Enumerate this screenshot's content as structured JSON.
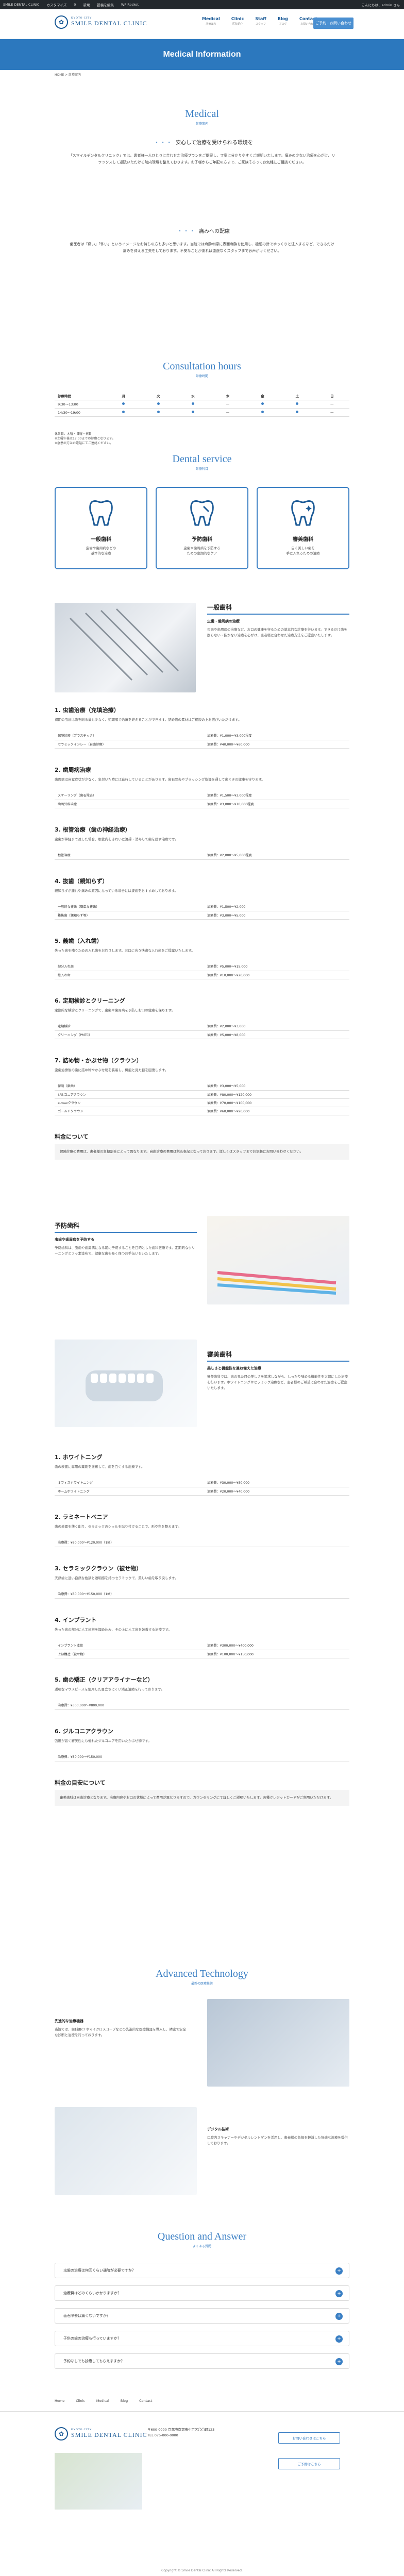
{
  "adminbar": {
    "items": [
      "SMILE DENTAL CLINIC",
      "カスタマイズ",
      "0",
      "新規",
      "投稿を編集",
      "WP Rocket"
    ],
    "right": "こんにちは、admin さん"
  },
  "header": {
    "logo_small": "KYOTO CITY",
    "logo_big": "SMILE DENTAL CLINIC",
    "nav": [
      {
        "label": "Medical",
        "sub": "診療案内"
      },
      {
        "label": "Clinic",
        "sub": "医院紹介"
      },
      {
        "label": "Staff",
        "sub": "スタッフ"
      },
      {
        "label": "Blog",
        "sub": "ブログ"
      },
      {
        "label": "Contact",
        "sub": "お問い合わせ"
      }
    ],
    "cta": "ご予約・お問い合わせ"
  },
  "hero_title": "Medical Information",
  "breadcrumb": "HOME > 診療案内",
  "medical": {
    "en": "Medical",
    "jp": "診療案内",
    "sub1": "安心して治療を受けられる環境を",
    "p1": "「スマイルデンタルクリニック」では、患者様一人ひとりに合わせた治療プランをご提案し、丁寧に分かりやすくご説明いたします。痛みの少ない治療を心がけ、リラックスして通院いただける院内環境を整えております。お子様からご年配の方まで、ご家族そろってお気軽にご相談ください。",
    "sub2": "痛みへの配慮",
    "p2": "歯医者は「痛い」「怖い」というイメージをお持ちの方も多いと思います。当院では麻酔の際に表面麻酔を使用し、極細の針でゆっくりと注入するなど、できるだけ痛みを抑える工夫をしております。不安なことがあれば遠慮なくスタッフまでお声がけください。"
  },
  "hours": {
    "en": "Consultation hours",
    "jp": "診療時間",
    "head": [
      "診療時間",
      "月",
      "火",
      "水",
      "木",
      "金",
      "土",
      "日"
    ],
    "rows": [
      {
        "label": "9:30〜13:00",
        "marks": [
          true,
          true,
          true,
          false,
          true,
          true,
          false
        ]
      },
      {
        "label": "14:30〜19:00",
        "marks": [
          true,
          true,
          true,
          false,
          true,
          true,
          false
        ]
      }
    ],
    "notes": [
      "休診日：木曜・日曜・祝日",
      "※土曜午後は17:00までの診療となります。",
      "※急患の方はお電話にてご連絡ください。"
    ]
  },
  "service": {
    "en": "Dental service",
    "jp": "診療科目",
    "cards": [
      {
        "title": "一般歯科",
        "desc": "虫歯や歯周病などの\n基本的な治療"
      },
      {
        "title": "予防歯科",
        "desc": "虫歯や歯周病を予防する\nための定期的なケア"
      },
      {
        "title": "審美歯科",
        "desc": "白く美しい歯を\n手に入れるための治療"
      }
    ]
  },
  "general": {
    "title": "一般歯科",
    "sub": "虫歯・歯周病の治療",
    "text": "虫歯や歯周病の治療など、お口の健康を守るための基本的な診療を行います。できるだけ歯を削らない・抜かない治療を心がけ、患者様に合わせた治療方法をご提案いたします。",
    "items": [
      {
        "h": "1. 虫歯治療（充填治療）",
        "p": "初期の虫歯は歯を削る量も少なく、短期間で治療を終えることができます。詰め物の素材はご相談の上お選びいただけます。",
        "rows": [
          [
            "保険診療（プラスチック）",
            "治療費：¥1,000〜¥3,000程度"
          ],
          [
            "セラミックインレー（自由診療）",
            "治療費：¥40,000〜¥60,000"
          ]
        ]
      },
      {
        "h": "2. 歯周病治療",
        "p": "歯周病は自覚症状が少なく、気付いた時には進行していることがあります。歯石除去やブラッシング指導を通して歯ぐきの健康を守ります。",
        "rows": [
          [
            "スケーリング（歯石除去）",
            "治療費：¥1,500〜¥3,000程度"
          ],
          [
            "歯周外科治療",
            "治療費：¥3,000〜¥10,000程度"
          ]
        ]
      },
      {
        "h": "3. 根管治療（歯の神経治療）",
        "p": "虫歯が神経まで達した場合、根管内をきれいに清掃・消毒して歯を残す治療です。",
        "rows": [
          [
            "根管治療",
            "治療費：¥2,000〜¥5,000程度"
          ]
        ]
      },
      {
        "h": "4. 抜歯（親知らず）",
        "p": "親知らずが腫れや痛みの原因になっている場合には抜歯をおすすめしております。",
        "rows": [
          [
            "一般的な抜歯（簡単な抜歯）",
            "治療費：¥1,500〜¥2,000"
          ],
          [
            "難抜歯（親知らず等）",
            "治療費：¥3,000〜¥5,000"
          ]
        ]
      },
      {
        "h": "5. 義歯（入れ歯）",
        "p": "失った歯を補うための入れ歯をお作りします。お口に合う快適な入れ歯をご提案いたします。",
        "rows": [
          [
            "部分入れ歯",
            "治療費：¥5,000〜¥15,000"
          ],
          [
            "総入れ歯",
            "治療費：¥10,000〜¥20,000"
          ]
        ]
      },
      {
        "h": "6. 定期検診とクリーニング",
        "p": "定期的な検診とクリーニングで、虫歯や歯周病を予防しお口の健康を保ちます。",
        "rows": [
          [
            "定期検診",
            "治療費：¥2,000〜¥3,000"
          ],
          [
            "クリーニング（PMTC）",
            "治療費：¥5,000〜¥8,000"
          ]
        ]
      },
      {
        "h": "7. 詰め物・かぶせ物（クラウン）",
        "p": "虫歯治療後の歯に詰め物やかぶせ物を装着し、機能と見た目を回復します。",
        "rows": [
          [
            "保険（銀歯）",
            "治療費：¥3,000〜¥5,000"
          ],
          [
            "ジルコニアクラウン",
            "治療費：¥80,000〜¥120,000"
          ],
          [
            "e-maxクラウン",
            "治療費：¥70,000〜¥100,000"
          ],
          [
            "ゴールドクラウン",
            "治療費：¥60,000〜¥90,000"
          ]
        ]
      }
    ],
    "fee_h": "料金について",
    "fee_p": "保険診療の費用は、患者様の負担割合によって異なります。自由診療の費用は税込表記となっております。詳しくはスタッフまでお気軽にお問い合わせください。"
  },
  "prevention": {
    "title": "予防歯科",
    "sub": "虫歯や歯周病を予防する",
    "text": "予防歯科は、虫歯や歯周病になる前に予防することを目的とした歯科医療です。定期的なクリーニングとフッ素塗布で、健康な歯を長く保つお手伝いをいたします。"
  },
  "aesthetic": {
    "title": "審美歯科",
    "sub": "美しさと機能性を兼ね備えた治療",
    "text": "審美歯科では、歯の見た目の美しさを追求しながら、しっかり噛める機能性を大切にした治療を行います。ホワイトニングやセラミック治療など、患者様のご希望に合わせた治療をご提案いたします。",
    "items": [
      {
        "h": "1. ホワイトニング",
        "p": "歯の表面に専用の薬剤を塗布して、歯を白くする治療です。",
        "rows": [
          [
            "オフィスホワイトニング",
            "治療費：¥30,000〜¥50,000"
          ],
          [
            "ホームホワイトニング",
            "治療費：¥20,000〜¥40,000"
          ]
        ]
      },
      {
        "h": "2. ラミネートベニア",
        "p": "歯の表面を薄く削り、セラミックのシェルを貼り付けることで、形や色を整えます。",
        "rows": [
          [
            "治療費：¥80,000〜¥120,000（1歯）",
            ""
          ]
        ]
      },
      {
        "h": "3. セラミッククラウン（被せ物）",
        "p": "天然歯に近い自然な色調と透明感を持つセラミックで、美しい歯を取り戻します。",
        "rows": [
          [
            "治療費：¥80,000〜¥150,000（1歯）",
            ""
          ]
        ]
      },
      {
        "h": "4. インプラント",
        "p": "失った歯の部分に人工歯根を埋め込み、その上に人工歯を装着する治療です。",
        "rows": [
          [
            "インプラント本体",
            "治療費：¥300,000〜¥400,000"
          ],
          [
            "上部構造（被せ物）",
            "治療費：¥100,000〜¥150,000"
          ]
        ]
      },
      {
        "h": "5. 歯の矯正（クリアアライナーなど）",
        "p": "透明なマウスピースを使用した目立ちにくい矯正治療を行っております。",
        "rows": [
          [
            "治療費：¥300,000〜¥800,000",
            ""
          ]
        ]
      },
      {
        "h": "6. ジルコニアクラウン",
        "p": "強度が高く審美性にも優れたジルコニアを用いたかぶせ物です。",
        "rows": [
          [
            "治療費：¥80,000〜¥150,000",
            ""
          ]
        ]
      }
    ],
    "fee_h": "料金の目安について",
    "fee_p": "審美歯科は自由診療となります。治療内容やお口の状態によって費用が異なりますので、カウンセリングにて詳しくご説明いたします。各種クレジットカードがご利用いただけます。"
  },
  "technology": {
    "en": "Advanced Technology",
    "jp": "最新の医療技術",
    "b1_title": "先進的な治療機器",
    "b1_text": "当院では、歯科用CTやマイクロスコープなどの先進的な医療機器を導入し、精密で安全な診断と治療を行っております。",
    "b2_title": "デジタル技術",
    "b2_text": "口腔内スキャナーやデジタルレントゲンを活用し、患者様の負担を軽減した快適な治療を提供しております。"
  },
  "qa": {
    "en": "Question and Answer",
    "jp": "よくある質問",
    "items": [
      "虫歯の治療は何回くらい通院が必要ですか？",
      "治療費はどのくらいかかりますか？",
      "歯石除去は痛くないですか？",
      "子供の歯の治療も行っていますか？",
      "予約なしでも診療してもらえますか？"
    ]
  },
  "footer": {
    "nav": [
      "Home",
      "Clinic",
      "Medical",
      "Blog",
      "Contact"
    ],
    "address": "〒600-0000 京都府京都市中京区〇〇町123",
    "tel": "TEL 075-000-0000",
    "btn1": "お問い合わせはこちら",
    "btn2": "ご予約はこちら",
    "copyright": "Copyright © Smile Dental Clinic All Rights Reserved."
  }
}
